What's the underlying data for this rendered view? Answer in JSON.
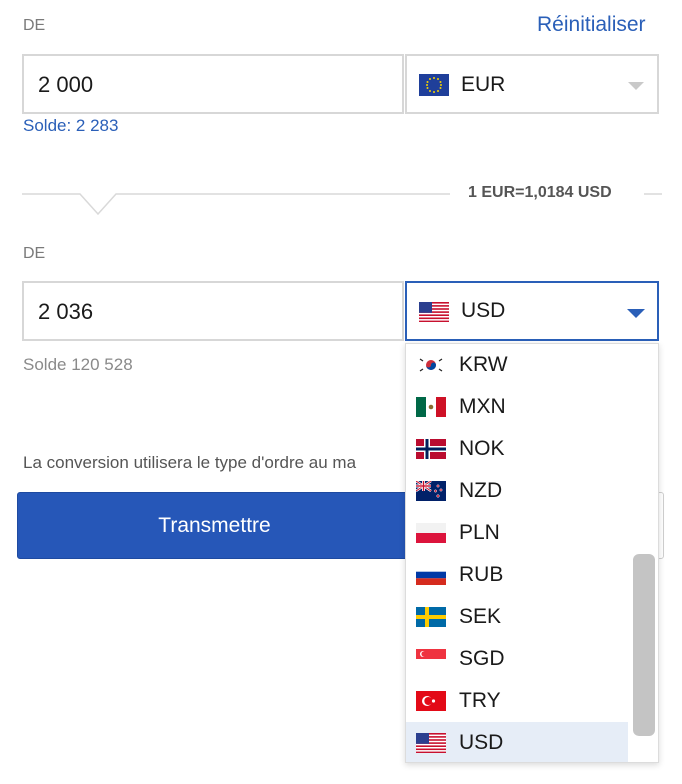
{
  "from": {
    "label": "DE",
    "reset_label": "Réinitialiser",
    "amount": "2 000",
    "currency": "EUR",
    "balance": "Solde: 2 283"
  },
  "rate": "1 EUR=1,0184 USD",
  "to": {
    "label": "DE",
    "amount": "2 036",
    "currency": "USD",
    "balance": "Solde 120 528"
  },
  "note": "La conversion utilisera le type d'ordre au ma",
  "submit_label": "Transmettre",
  "dropdown": {
    "items": [
      {
        "code": "KRW",
        "flag": "south-korea-flag-icon"
      },
      {
        "code": "MXN",
        "flag": "mexico-flag-icon"
      },
      {
        "code": "NOK",
        "flag": "norway-flag-icon"
      },
      {
        "code": "NZD",
        "flag": "new-zealand-flag-icon"
      },
      {
        "code": "PLN",
        "flag": "poland-flag-icon"
      },
      {
        "code": "RUB",
        "flag": "russia-flag-icon"
      },
      {
        "code": "SEK",
        "flag": "sweden-flag-icon"
      },
      {
        "code": "SGD",
        "flag": "singapore-flag-icon"
      },
      {
        "code": "TRY",
        "flag": "turkey-flag-icon"
      },
      {
        "code": "USD",
        "flag": "usa-flag-icon"
      }
    ],
    "selected": "USD"
  },
  "colors": {
    "accent": "#2a5fb8",
    "button": "#2657b8",
    "selected_bg": "#e6edf7",
    "border": "#d7d7d7"
  }
}
